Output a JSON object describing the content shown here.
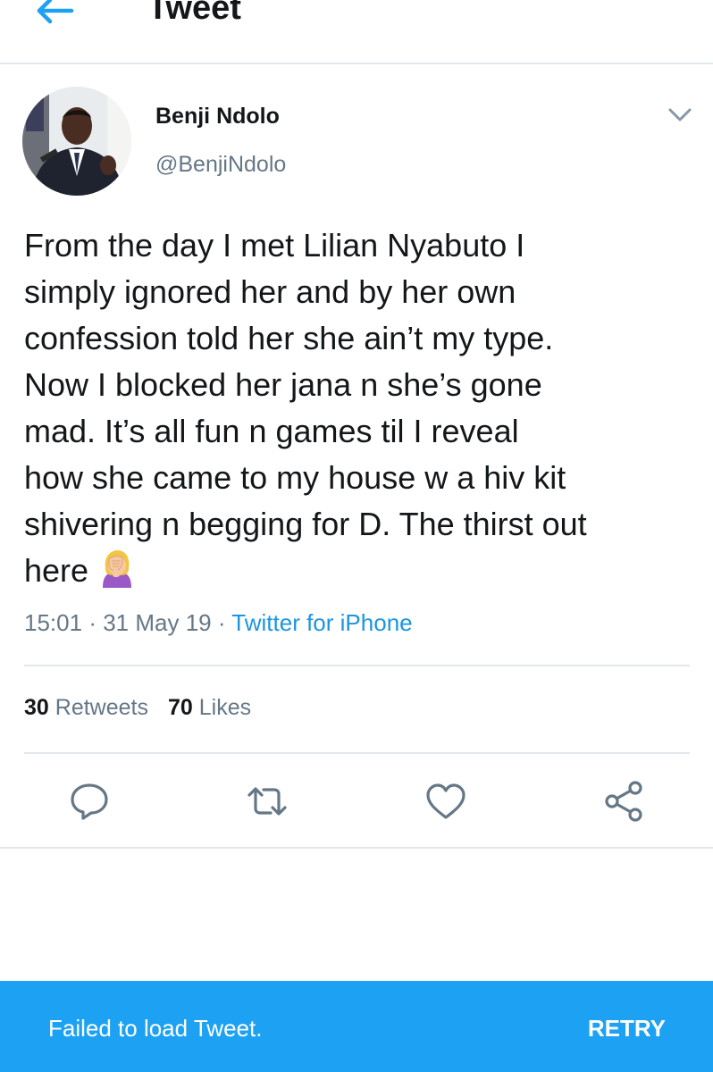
{
  "header": {
    "title": "Tweet"
  },
  "tweet": {
    "author_name": "Benji Ndolo",
    "author_handle": "@BenjiNdolo",
    "text_lines": [
      "From the day I met Lilian Nyabuto I",
      "simply ignored her and by her own",
      "confession told her she ain’t my type.",
      "Now I blocked her jana n she’s gone",
      "mad. It’s all fun n games til I reveal",
      "how she came to my house w a hiv kit",
      "shivering n begging for D. The thirst out",
      "here"
    ],
    "emoji": "woman-facepalming-icon",
    "time": "15:01",
    "date": "31 May 19",
    "separator": "·",
    "source": "Twitter for iPhone",
    "retweets_count": "30",
    "retweets_label": "Retweets",
    "likes_count": "70",
    "likes_label": "Likes"
  },
  "actions": [
    "reply-icon",
    "retweet-icon",
    "like-icon",
    "share-icon"
  ],
  "snackbar": {
    "message": "Failed to load Tweet.",
    "action": "RETRY"
  },
  "colors": {
    "accent": "#1da1f2",
    "link": "#1b95e0",
    "muted": "#657786",
    "text": "#14171a",
    "divider": "#e1e8ed"
  }
}
